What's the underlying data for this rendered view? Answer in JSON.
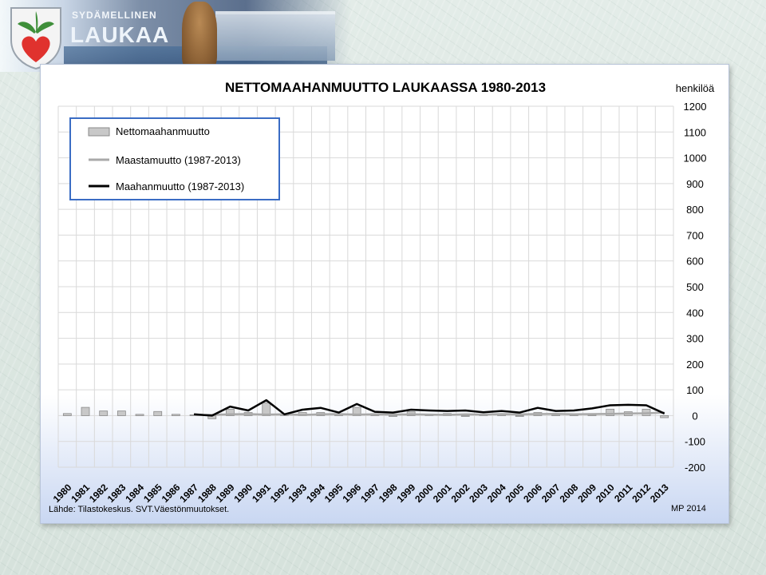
{
  "header": {
    "brand_small": "SYDÄMELLINEN",
    "brand_big": "LAUKAA"
  },
  "colors": {
    "bar": "#c8c8c8",
    "bar_stroke": "#8a8a8a",
    "emigration_line": "#a9a9a9",
    "immigration_line": "#000000",
    "grid": "#d9d9d9",
    "legend_border": "#3a6cc4",
    "panel_border": "#b8c4d8",
    "logo_red": "#e0322e",
    "logo_green": "#3f8f3a"
  },
  "chart_data": {
    "type": "bar",
    "title": "NETTOMAAHANMUUTTO  LAUKAASSA  1980-2013",
    "ylabel": "henkilöä",
    "xlabel": "",
    "ylim": [
      -200,
      1200
    ],
    "yticks": [
      1200,
      1100,
      1000,
      900,
      800,
      700,
      600,
      500,
      400,
      300,
      200,
      100,
      0,
      -100,
      -200
    ],
    "grid": true,
    "legend_position": "top-left",
    "categories": [
      "1980",
      "1981",
      "1982",
      "1983",
      "1984",
      "1985",
      "1986",
      "1987",
      "1988",
      "1989",
      "1990",
      "1991",
      "1992",
      "1993",
      "1994",
      "1995",
      "1996",
      "1997",
      "1998",
      "1999",
      "2000",
      "2001",
      "2002",
      "2003",
      "2004",
      "2005",
      "2006",
      "2007",
      "2008",
      "2009",
      "2010",
      "2011",
      "2012",
      "2013"
    ],
    "series": [
      {
        "name": "Nettomaahanmuutto",
        "kind": "bar",
        "values": [
          8,
          32,
          18,
          18,
          5,
          16,
          5,
          3,
          -12,
          25,
          12,
          50,
          5,
          12,
          12,
          6,
          32,
          8,
          0,
          15,
          3,
          8,
          0,
          3,
          5,
          0,
          12,
          3,
          5,
          3,
          25,
          15,
          25,
          -8
        ]
      },
      {
        "name": "Maastamuutto (1987-2013)",
        "kind": "line",
        "start_year": "1987",
        "values": [
          2,
          3,
          5,
          6,
          4,
          5,
          3,
          5,
          6,
          4,
          5,
          4,
          5,
          4,
          3,
          5,
          4,
          6,
          5,
          6,
          7,
          5,
          6,
          7,
          8,
          9,
          12
        ]
      },
      {
        "name": "Maahanmuutto (1987-2013)",
        "kind": "line",
        "start_year": "1987",
        "values": [
          5,
          0,
          35,
          20,
          60,
          5,
          23,
          30,
          12,
          45,
          15,
          12,
          23,
          20,
          18,
          20,
          13,
          18,
          12,
          30,
          18,
          20,
          28,
          40,
          42,
          40,
          8
        ]
      }
    ]
  },
  "footer": {
    "source": "Lähde: Tilastokeskus. SVT.Väestönmuutokset.",
    "credit": "MP 2014"
  }
}
